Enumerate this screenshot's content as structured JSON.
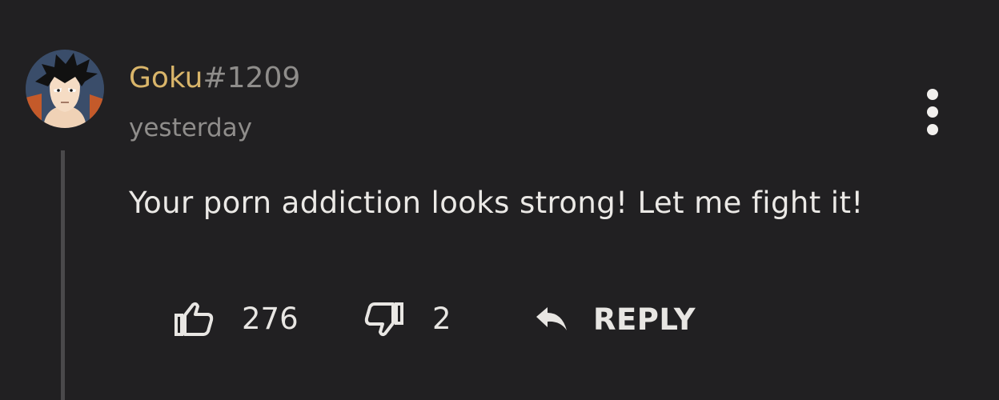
{
  "comment": {
    "author": {
      "username": "Goku",
      "discriminator": "#1209",
      "avatar_icon": "goku-avatar-icon"
    },
    "timestamp": "yesterday",
    "text": "Your porn addiction looks strong! Let me fight it!",
    "likes": "276",
    "dislikes": "2",
    "reply_label": "REPLY"
  },
  "icons": {
    "like": "thumbs-up-icon",
    "dislike": "thumbs-down-icon",
    "reply": "reply-arrow-icon",
    "more": "more-vertical-icon"
  },
  "colors": {
    "background": "#212022",
    "username": "#d9b56a",
    "muted": "#8f8d8b",
    "text": "#e8e6e3",
    "thread_line": "#4a494b"
  }
}
